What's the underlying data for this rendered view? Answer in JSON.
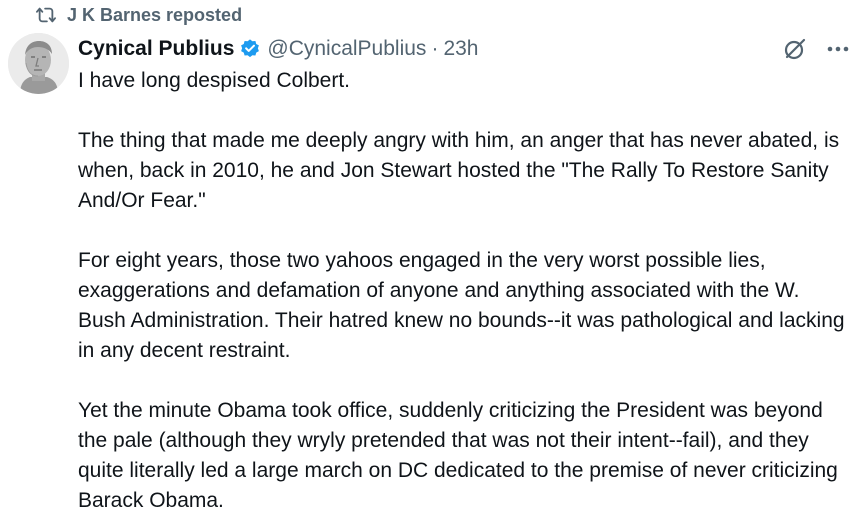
{
  "repost": {
    "icon": "repost-icon",
    "label": "J K Barnes reposted"
  },
  "author": {
    "avatar_icon": "roman-bust-avatar",
    "display_name": "Cynical Publius",
    "verified_icon": "verified-badge-icon",
    "verified_color": "#1d9bf0",
    "handle": "@CynicalPublius",
    "separator": "·",
    "time": "23h"
  },
  "actions": {
    "grok_icon": "grok-icon",
    "more_icon": "more-options-icon"
  },
  "tweet": {
    "paragraphs": [
      "I have long despised Colbert.",
      "The thing that made me deeply angry with him, an anger that has never abated, is when, back in 2010, he and Jon Stewart hosted the \"The Rally To Restore Sanity And/Or Fear.\"",
      "For eight years, those two yahoos engaged in the very worst possible lies, exaggerations and defamation of anyone and anything associated with the W. Bush Administration.  Their hatred knew no bounds--it was pathological and lacking in any decent restraint.",
      "Yet the minute Obama took office, suddenly criticizing the President was beyond the pale (although they wryly pretended that was not their intent--fail), and they quite literally led a large march on DC dedicated to the premise of never criticizing Barack Obama."
    ]
  },
  "colors": {
    "text": "#0f1419",
    "secondary": "#536471",
    "accent": "#1d9bf0"
  }
}
